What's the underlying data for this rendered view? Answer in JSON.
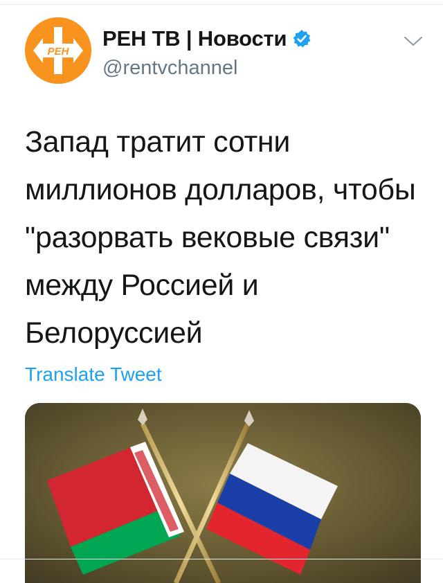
{
  "account": {
    "display_name": "РЕН ТВ | Новости",
    "handle": "@rentvchannel",
    "logo_text": "РЕН",
    "brand_color": "#f7931e",
    "verified": true
  },
  "tweet": {
    "text": "Запад тратит сотни миллионов долларов, чтобы \"разорвать вековые связи\" между Россией и Белоруссией",
    "translate_label": "Translate Tweet"
  },
  "media": {
    "description": "",
    "flags": [
      "belarus-flag",
      "russia-flag"
    ]
  },
  "colors": {
    "link": "#1da1f2",
    "secondary_text": "#657786",
    "verified_badge": "#1da1f2"
  }
}
